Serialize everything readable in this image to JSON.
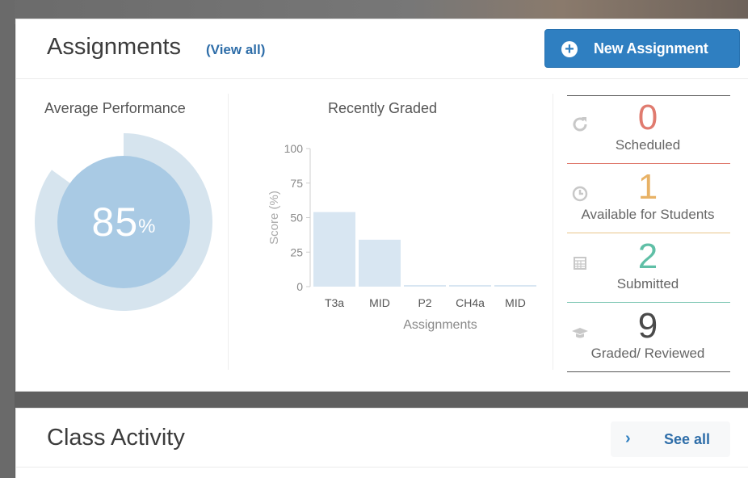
{
  "assignments": {
    "title": "Assignments",
    "view_all": "(View all)",
    "new_button": "New Assignment",
    "average": {
      "heading": "Average Performance",
      "value": "85",
      "unit": "%",
      "percent": 0.85
    },
    "recent": {
      "heading": "Recently Graded"
    },
    "stats": [
      {
        "count": "0",
        "label": "Scheduled",
        "icon": "refresh-icon",
        "color": "#e07b6f"
      },
      {
        "count": "1",
        "label": "Available for Students",
        "icon": "clock-icon",
        "color": "#e8b266"
      },
      {
        "count": "2",
        "label": "Submitted",
        "icon": "calendar-icon",
        "color": "#5fbfa6"
      },
      {
        "count": "9",
        "label": "Graded/ Reviewed",
        "icon": "graduation-cap-icon",
        "color": "#4a4a4a"
      }
    ]
  },
  "chart_data": {
    "type": "bar",
    "title": "Recently Graded",
    "xlabel": "Assignments",
    "ylabel": "Score (%)",
    "ylim": [
      0,
      100
    ],
    "yticks": [
      0,
      25,
      50,
      75,
      100
    ],
    "categories": [
      "T3a",
      "MID",
      "P2",
      "CH4a",
      "MID"
    ],
    "values": [
      54,
      34,
      0,
      0,
      0
    ],
    "bar_color": "#d8e6f2",
    "grid": false,
    "legend": "none"
  },
  "activity": {
    "title": "Class Activity",
    "see_all": "See all"
  },
  "colors": {
    "accent": "#2f7fc1",
    "donut_fill": "#a9cae4",
    "donut_ring": "#d6e4ee"
  }
}
